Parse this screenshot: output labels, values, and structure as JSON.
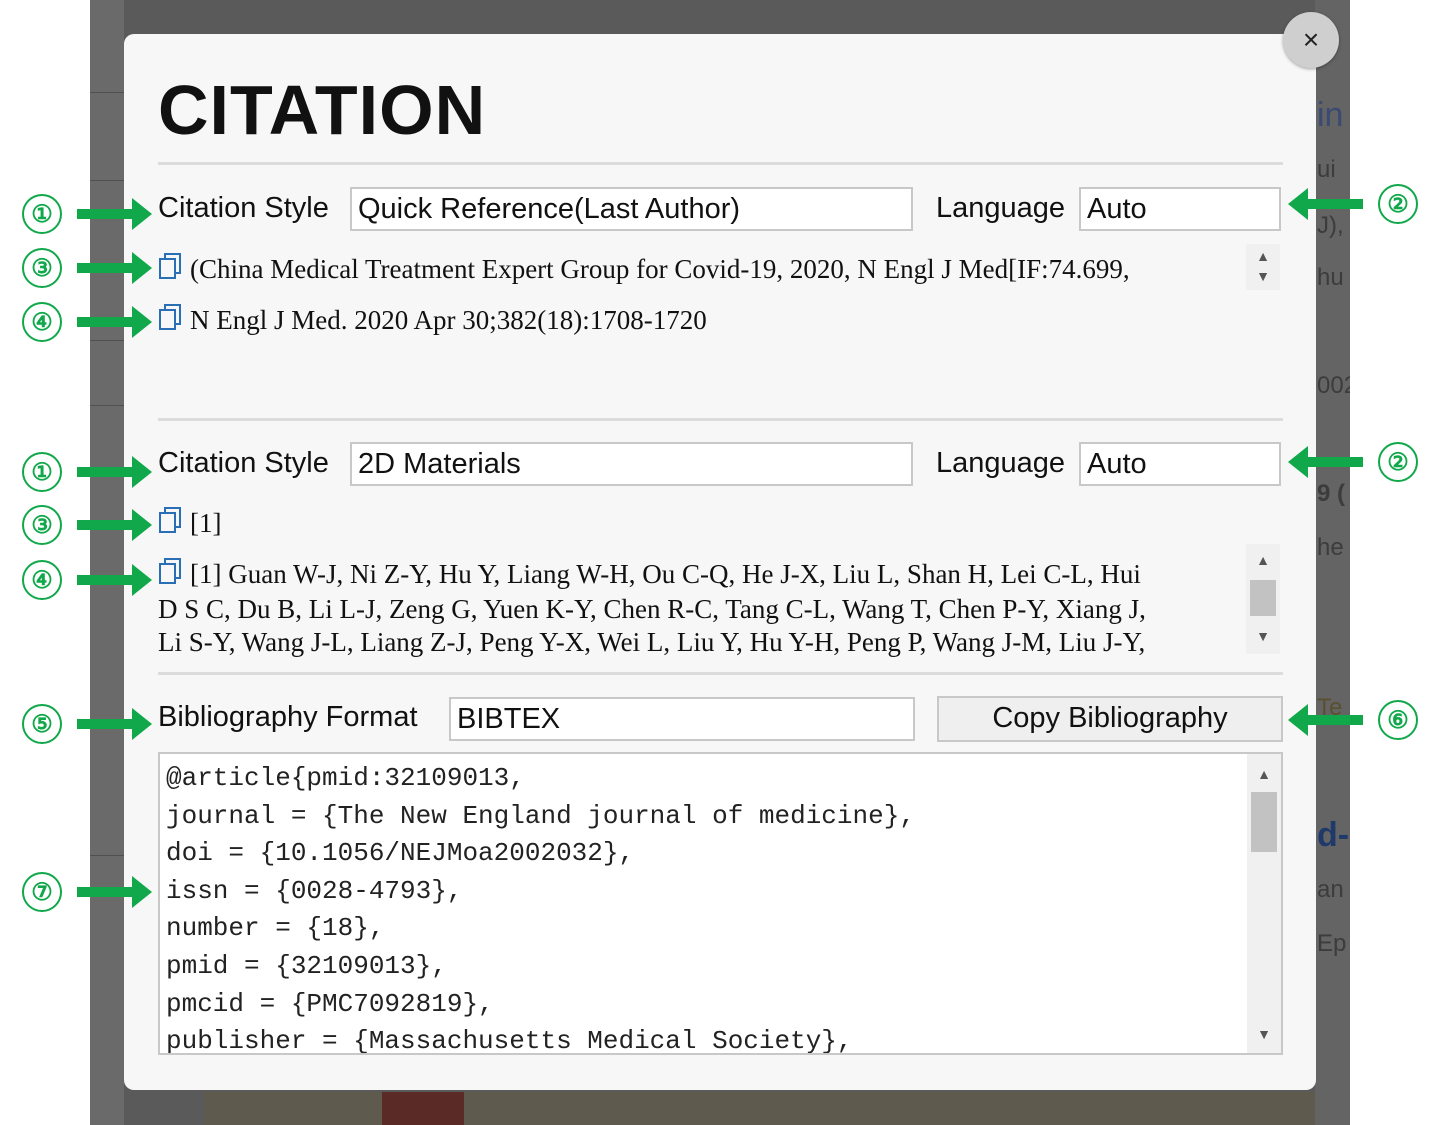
{
  "modal": {
    "title": "CITATION",
    "close_label": "×"
  },
  "section1": {
    "style_label": "Citation Style",
    "style_value": "Quick Reference(Last Author)",
    "language_label": "Language",
    "language_value": "Auto",
    "citation_line1": "(China Medical Treatment Expert Group for Covid-19, 2020, N Engl J Med[IF:74.699,",
    "citation_line2": "N Engl J Med. 2020 Apr 30;382(18):1708-1720"
  },
  "section2": {
    "style_label": "Citation Style",
    "style_value": "2D Materials",
    "language_label": "Language",
    "language_value": "Auto",
    "citation_line1": "[1]",
    "reference_lines": [
      "[1] Guan W-J, Ni Z-Y, Hu Y, Liang W-H, Ou C-Q, He J-X, Liu L, Shan H, Lei C-L, Hui",
      "D S C, Du B, Li L-J, Zeng G, Yuen K-Y, Chen R-C, Tang C-L, Wang T, Chen P-Y, Xiang J,",
      "Li S-Y, Wang J-L, Liang Z-J, Peng Y-X, Wei L, Liu Y, Hu Y-H, Peng P, Wang J-M, Liu J-Y,"
    ]
  },
  "bibliography": {
    "format_label": "Bibliography Format",
    "format_value": "BIBTEX",
    "copy_button": "Copy Bibliography",
    "lines": [
      "@article{pmid:32109013,",
      "journal = {The New England journal of medicine},",
      "doi = {10.1056/NEJMoa2002032},",
      "issn = {0028-4793},",
      "number = {18},",
      "pmid = {32109013},",
      "pmcid = {PMC7092819},",
      "publisher = {Massachusetts Medical Society},"
    ]
  },
  "annotations": [
    "①",
    "②",
    "③",
    "④",
    "①",
    "②",
    "③",
    "④",
    "⑤",
    "⑥",
    "⑦"
  ],
  "background_fragments": [
    "in",
    "ui",
    "J),",
    "hu",
    "002",
    "9 (",
    "he",
    "Te",
    "d-",
    "an",
    "Ep"
  ],
  "colors": {
    "annotation_green": "#10a84a",
    "backdrop": "#5a5a5a",
    "modal_bg": "#f7f7f7"
  }
}
